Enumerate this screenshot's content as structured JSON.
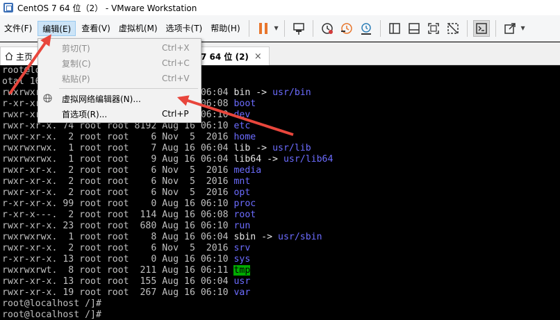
{
  "window": {
    "title": "CentOS 7 64 位（2） - VMware Workstation"
  },
  "menubar": {
    "items": [
      {
        "label": "文件(F)"
      },
      {
        "label": "编辑(E)"
      },
      {
        "label": "查看(V)"
      },
      {
        "label": "虚拟机(M)"
      },
      {
        "label": "选项卡(T)"
      },
      {
        "label": "帮助(H)"
      }
    ]
  },
  "tabs": {
    "home_label": "主页",
    "vm_label": "7 64 位 (2)",
    "close_glyph": "×"
  },
  "edit_menu": {
    "items": [
      {
        "label": "剪切(T)",
        "shortcut": "Ctrl+X",
        "disabled": true
      },
      {
        "label": "复制(C)",
        "shortcut": "Ctrl+C",
        "disabled": true
      },
      {
        "label": "粘贴(P)",
        "shortcut": "Ctrl+V",
        "disabled": true
      },
      {
        "label": "虚拟网络编辑器(N)...",
        "shortcut": "",
        "icon": "globe-icon"
      },
      {
        "label": "首选项(R)...",
        "shortcut": "Ctrl+P"
      }
    ]
  },
  "terminal": {
    "lines": [
      {
        "text": "root@localhost /]# ls -l"
      },
      {
        "text": "otal 16"
      },
      {
        "text": "rwxrwxrwx.  1 root root    7 Aug 16 06:04 ",
        "name": "bin",
        "link": "usr/bin"
      },
      {
        "text": "r-xr-xr-x.  5 root root 4096 Aug 16 06:08 ",
        "name": "boot"
      },
      {
        "text": "rwxr-xr-x. 20 root root 3320 Aug 16 06:10 ",
        "name": "dev"
      },
      {
        "text": "rwxr-xr-x. 74 root root 8192 Aug 16 06:10 ",
        "name": "etc"
      },
      {
        "text": "rwxr-xr-x.  2 root root    6 Nov  5  2016 ",
        "name": "home"
      },
      {
        "text": "rwxrwxrwx.  1 root root    7 Aug 16 06:04 ",
        "name": "lib",
        "link": "usr/lib"
      },
      {
        "text": "rwxrwxrwx.  1 root root    9 Aug 16 06:04 ",
        "name": "lib64",
        "link": "usr/lib64"
      },
      {
        "text": "rwxr-xr-x.  2 root root    6 Nov  5  2016 ",
        "name": "media"
      },
      {
        "text": "rwxr-xr-x.  2 root root    6 Nov  5  2016 ",
        "name": "mnt"
      },
      {
        "text": "rwxr-xr-x.  2 root root    6 Nov  5  2016 ",
        "name": "opt"
      },
      {
        "text": "r-xr-xr-x. 99 root root    0 Aug 16 06:10 ",
        "name": "proc"
      },
      {
        "text": "r-xr-x---.  2 root root  114 Aug 16 06:08 ",
        "name": "root"
      },
      {
        "text": "rwxr-xr-x. 23 root root  680 Aug 16 06:10 ",
        "name": "run"
      },
      {
        "text": "rwxrwxrwx.  1 root root    8 Aug 16 06:04 ",
        "name": "sbin",
        "link": "usr/sbin"
      },
      {
        "text": "rwxr-xr-x.  2 root root    6 Nov  5  2016 ",
        "name": "srv"
      },
      {
        "text": "r-xr-xr-x. 13 root root    0 Aug 16 06:10 ",
        "name": "sys"
      },
      {
        "text": "rwxrwxrwt.  8 root root  211 Aug 16 06:11 ",
        "name": "tmp",
        "highlight": true
      },
      {
        "text": "rwxr-xr-x. 13 root root  155 Aug 16 06:04 ",
        "name": "usr"
      },
      {
        "text": "rwxr-xr-x. 19 root root  267 Aug 16 06:10 ",
        "name": "var"
      },
      {
        "text": "root@localhost /]#"
      },
      {
        "text": "root@localhost /]#"
      }
    ],
    "link_arrow": " -> ",
    "colors": {
      "dir": "#6c6cff",
      "text": "#c0c0c0",
      "highlight": "#00aa00"
    }
  },
  "annotations": {
    "arrow_color": "#e8463c"
  },
  "icons": {
    "toolbar": [
      "pause-icon",
      "send-keys-icon",
      "snapshot-icon",
      "revert-snapshot-icon",
      "snapshot-manager-icon",
      "sidebar-icon",
      "thumbnail-icon",
      "fullscreen-icon",
      "unity-icon",
      "console-icon",
      "stretch-icon"
    ]
  }
}
